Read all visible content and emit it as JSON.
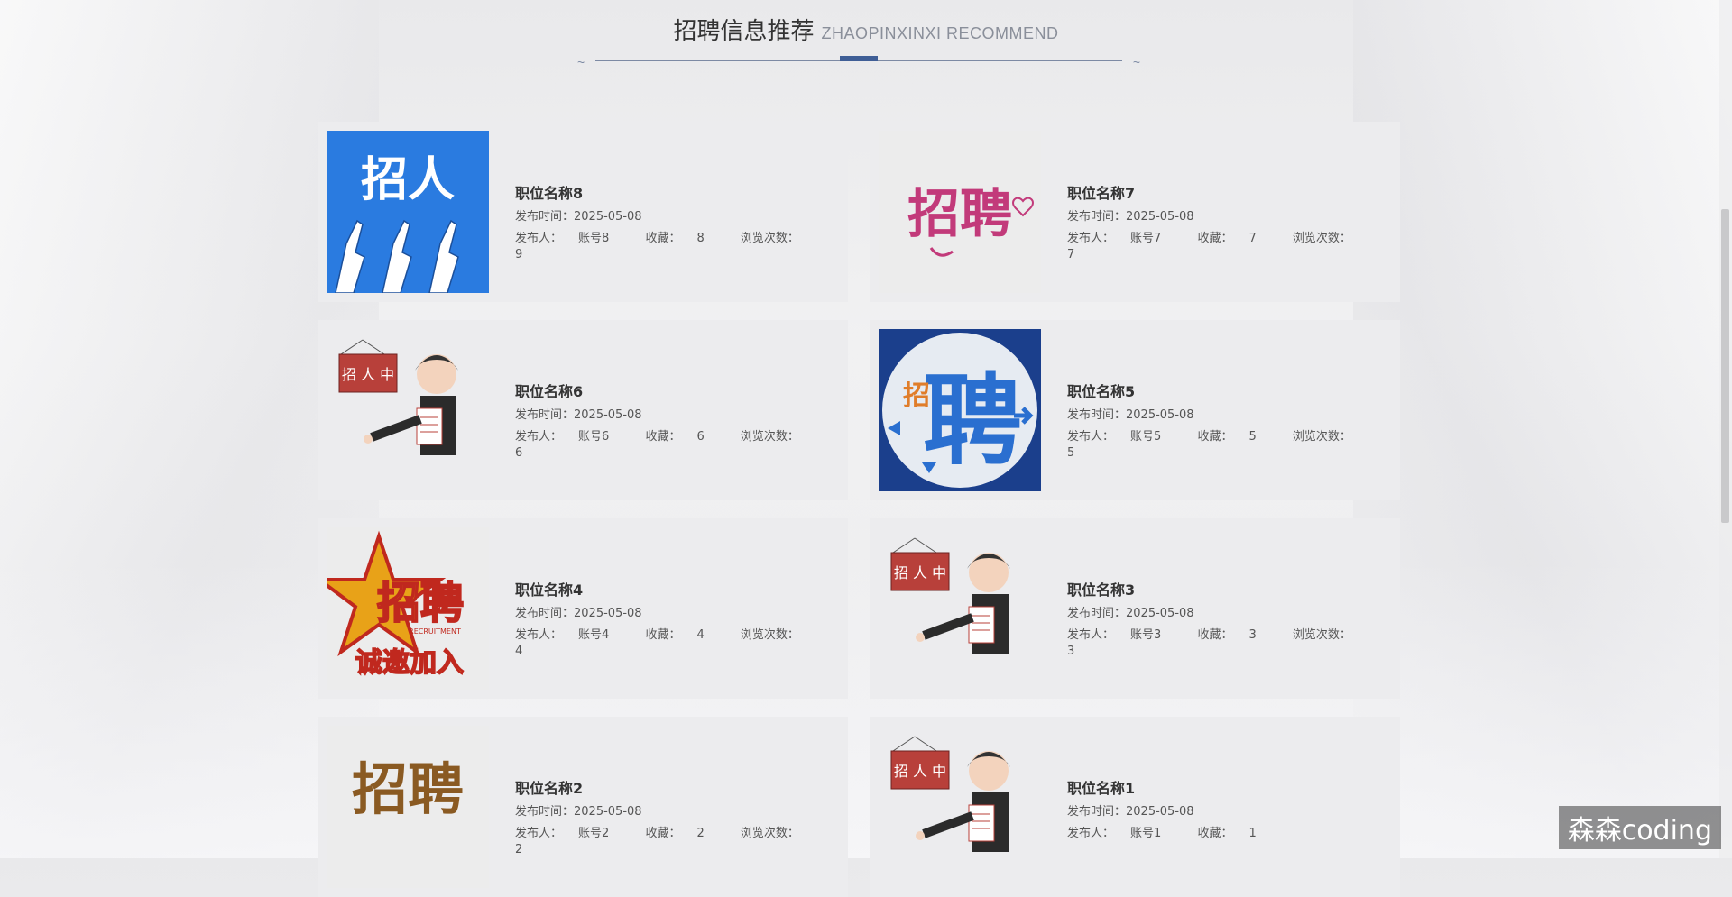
{
  "section": {
    "title": "招聘信息推荐",
    "subtitle": "ZHAOPINXINXI RECOMMEND"
  },
  "labels": {
    "publish_time": "发布时间：",
    "publisher": "发布人：",
    "favorites": "收藏：",
    "views": "浏览次数："
  },
  "jobs": [
    {
      "name": "职位名称8",
      "date": "2025-05-08",
      "publisher": "账号8",
      "favorites": "8",
      "views": "9",
      "image": "zhaoren-hands-image"
    },
    {
      "name": "职位名称7",
      "date": "2025-05-08",
      "publisher": "账号7",
      "favorites": "7",
      "views": "7",
      "image": "zhaopin-heart-image"
    },
    {
      "name": "职位名称6",
      "date": "2025-05-08",
      "publisher": "账号6",
      "favorites": "6",
      "views": "6",
      "image": "recruiter-cartoon-image"
    },
    {
      "name": "职位名称5",
      "date": "2025-05-08",
      "publisher": "账号5",
      "favorites": "5",
      "views": "5",
      "image": "pin-arrows-image"
    },
    {
      "name": "职位名称4",
      "date": "2025-05-08",
      "publisher": "账号4",
      "favorites": "4",
      "views": "4",
      "image": "zhaopin-star-image"
    },
    {
      "name": "职位名称3",
      "date": "2025-05-08",
      "publisher": "账号3",
      "favorites": "3",
      "views": "3",
      "image": "recruiter-cartoon-image"
    },
    {
      "name": "职位名称2",
      "date": "2025-05-08",
      "publisher": "账号2",
      "favorites": "2",
      "views": "2",
      "image": "zhaopin-gold-image"
    },
    {
      "name": "职位名称1",
      "date": "2025-05-08",
      "publisher": "账号1",
      "favorites": "1",
      "views": "",
      "image": "recruiter-cartoon-image"
    }
  ],
  "image_texts": {
    "zhaoren": "招人",
    "zhaopin": "招聘",
    "pin": "聘",
    "zhao": "招",
    "sign": "招 人 中",
    "slogan": "诚邀加入",
    "recruitment": "RECRUITMENT"
  },
  "watermark": "森森coding",
  "colors": {
    "accent": "#3f5e96",
    "card_bg": "#ececee",
    "blue_image": "#2a7be0",
    "pink_text": "#c23a7a"
  }
}
